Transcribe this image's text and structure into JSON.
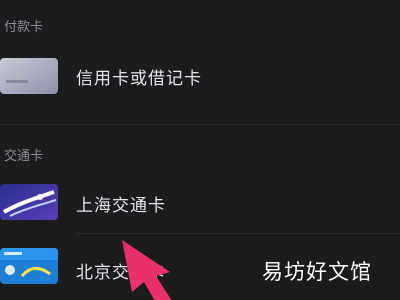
{
  "sections": [
    {
      "header": "付款卡",
      "items": [
        {
          "label": "信用卡或借记卡",
          "icon": "credit-card-icon"
        }
      ]
    },
    {
      "header": "交通卡",
      "items": [
        {
          "label": "上海交通卡",
          "icon": "shanghai-transit-card-icon"
        },
        {
          "label": "北京交通卡",
          "icon": "beijing-transit-card-icon"
        }
      ]
    }
  ],
  "watermark": "易坊好文馆",
  "colors": {
    "background": "#1c1c1e",
    "header_text": "#8e8e93",
    "label_text": "#e5e5ea",
    "pointer": "#e8306a"
  }
}
